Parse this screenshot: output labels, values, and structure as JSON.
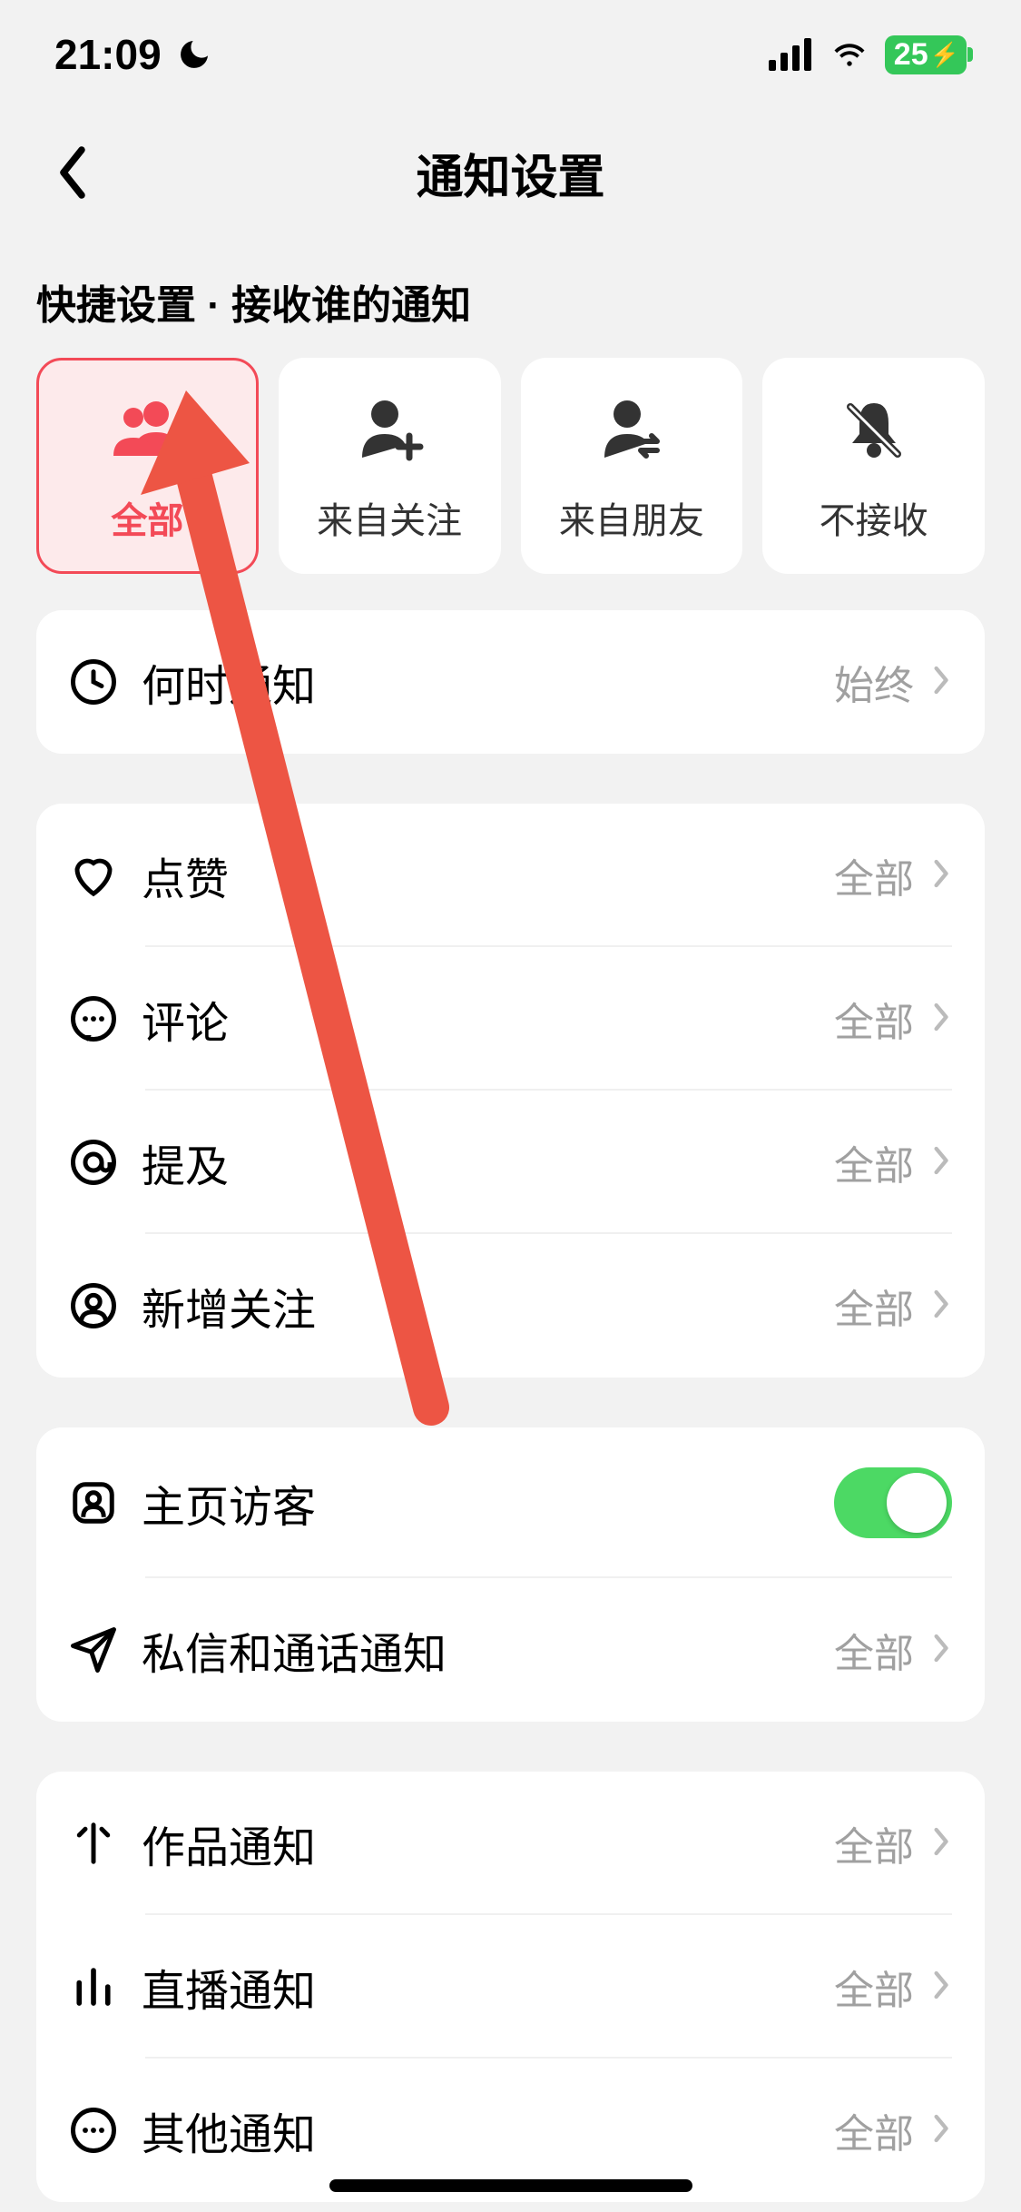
{
  "status_bar": {
    "time": "21:09",
    "battery": "25"
  },
  "header": {
    "title": "通知设置"
  },
  "quick_section": {
    "label": "快捷设置 · 接收谁的通知",
    "tiles": [
      {
        "label": "全部",
        "selected": true
      },
      {
        "label": "来自关注",
        "selected": false
      },
      {
        "label": "来自朋友",
        "selected": false
      },
      {
        "label": "不接收",
        "selected": false
      }
    ]
  },
  "groups": [
    {
      "id": "when",
      "rows": [
        {
          "icon": "clock",
          "label": "何时通知",
          "value": "始终",
          "type": "nav"
        }
      ]
    },
    {
      "id": "interactions",
      "rows": [
        {
          "icon": "heart",
          "label": "点赞",
          "value": "全部",
          "type": "nav"
        },
        {
          "icon": "chat",
          "label": "评论",
          "value": "全部",
          "type": "nav"
        },
        {
          "icon": "at",
          "label": "提及",
          "value": "全部",
          "type": "nav"
        },
        {
          "icon": "user",
          "label": "新增关注",
          "value": "全部",
          "type": "nav"
        }
      ]
    },
    {
      "id": "visitors-messages",
      "rows": [
        {
          "icon": "visitor",
          "label": "主页访客",
          "value": "",
          "type": "toggle",
          "on": true
        },
        {
          "icon": "send",
          "label": "私信和通话通知",
          "value": "全部",
          "type": "nav"
        }
      ]
    },
    {
      "id": "content",
      "rows": [
        {
          "icon": "sparkle",
          "label": "作品通知",
          "value": "全部",
          "type": "nav"
        },
        {
          "icon": "bars",
          "label": "直播通知",
          "value": "全部",
          "type": "nav"
        },
        {
          "icon": "more",
          "label": "其他通知",
          "value": "全部",
          "type": "nav"
        }
      ]
    }
  ]
}
